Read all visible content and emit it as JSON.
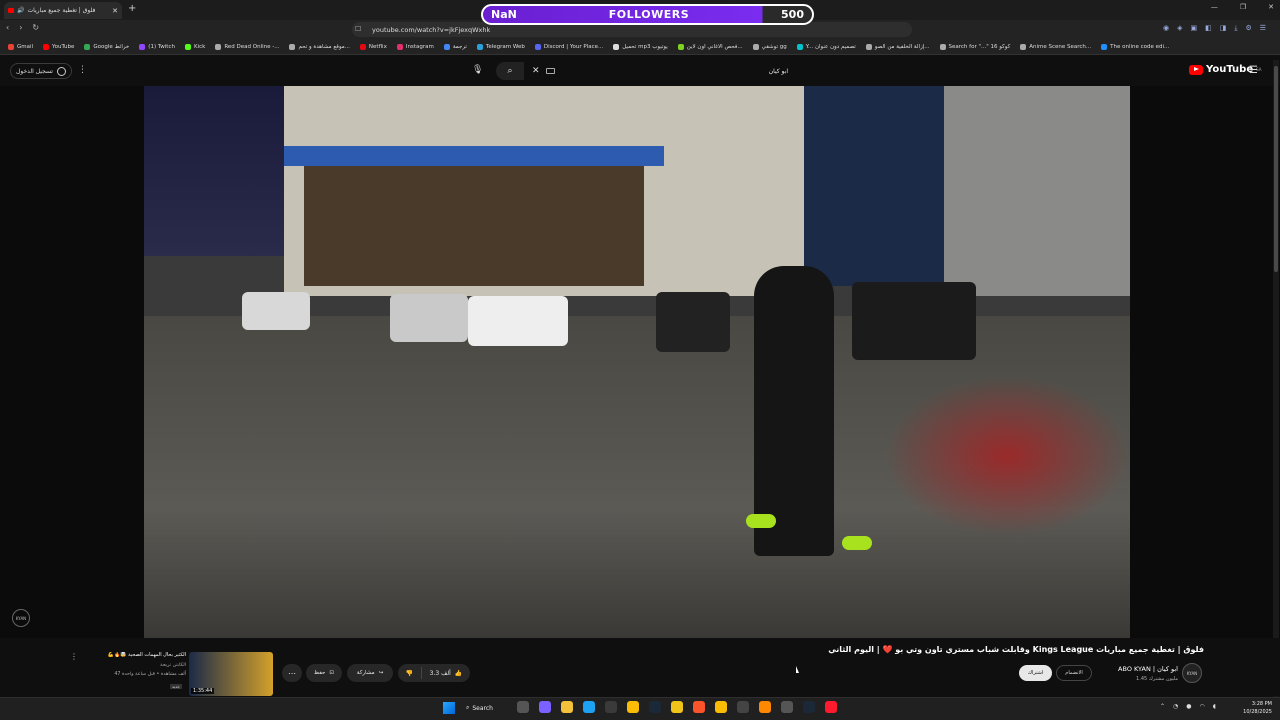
{
  "browser": {
    "tab_title": "فلوق | تغطية جميع مباريات",
    "new_tab": "+",
    "url": "youtube.com/watch?v=jkFjexqWxhk",
    "window_controls": [
      "—",
      "❐",
      "✕"
    ],
    "bookmarks": [
      {
        "label": "Gmail",
        "color": "#ea4335"
      },
      {
        "label": "YouTube",
        "color": "#ff0000"
      },
      {
        "label": "Google خرائط",
        "color": "#34a853"
      },
      {
        "label": "(1) Twitch",
        "color": "#9146ff"
      },
      {
        "label": "Kick",
        "color": "#53fc18"
      },
      {
        "label": "Red Dead Online -...",
        "color": "#aaaaaa"
      },
      {
        "label": "موقع مشاهدة و تحم...",
        "color": "#aaaaaa"
      },
      {
        "label": "Netflix",
        "color": "#e50914"
      },
      {
        "label": "Instagram",
        "color": "#e1306c"
      },
      {
        "label": "ترجمة",
        "color": "#4285f4"
      },
      {
        "label": "Telegram Web",
        "color": "#2aa1da"
      },
      {
        "label": "Discord | Your Place...",
        "color": "#5865f2"
      },
      {
        "label": "تحميل mp3 يوتيوب",
        "color": "#dddddd"
      },
      {
        "label": "فحص الاغاني اون لاين...",
        "color": "#7ed321"
      },
      {
        "label": "توشقي gg",
        "color": "#aaaaaa"
      },
      {
        "label": "Y... تصميم دون عنوان",
        "color": "#00c4cc"
      },
      {
        "label": "إزالة الخلفية من الصو...",
        "color": "#aaaaaa"
      },
      {
        "label": "Search for \"...\" كوكو 16",
        "color": "#aaaaaa"
      },
      {
        "label": "Anime Scene Search...",
        "color": "#aaaaaa"
      },
      {
        "label": "The online code edi...",
        "color": "#1e90ff"
      }
    ]
  },
  "overlay": {
    "left": "NaN",
    "label": "FOLLOWERS",
    "count": "500"
  },
  "youtube": {
    "signin": "تسجيل الدخول",
    "search_query": "ابو كيان",
    "logo": "YouTube",
    "logo_region": "SA",
    "video": {
      "title": "فلوق | تغطية جميع مباريات Kings League وقابلت شباب مستري تاون وتي بو ❤️ | اليوم الثاني",
      "channel": "ABO KYAN | ابو كيان",
      "subscribers": "1.45 مليون مشترك",
      "channel_avatar": "KYAN",
      "join": "الانضمام",
      "subscribe": "اشتراك",
      "likes": "3.3 ألف",
      "share": "مشاركة",
      "save": "حفظ",
      "more": "⋯"
    },
    "recommended": {
      "title": "الكثير بحال المهمات الصحية 🤯🔥💪",
      "channel": "الكابتن تريحة",
      "meta": "47 ألف مشاهدة • قبل ساعة واحدة",
      "duration": "1:35:44",
      "badge": "جديد"
    },
    "side_avatar": "KYAN"
  },
  "taskbar": {
    "search": "Search",
    "time": "3:28 PM",
    "date": "10/28/2025",
    "icons": [
      {
        "name": "task-view",
        "color": "#555555"
      },
      {
        "name": "copilot",
        "color": "#7b61ff"
      },
      {
        "name": "file-explorer",
        "color": "#f3c13a"
      },
      {
        "name": "edge",
        "color": "#1da1f2"
      },
      {
        "name": "store",
        "color": "#3a3a3a"
      },
      {
        "name": "chrome",
        "color": "#fbbc05"
      },
      {
        "name": "steam",
        "color": "#1b2838"
      },
      {
        "name": "app",
        "color": "#f0c419"
      },
      {
        "name": "brave",
        "color": "#fb542b"
      },
      {
        "name": "chrome-2",
        "color": "#fbbc05"
      },
      {
        "name": "obs",
        "color": "#444444"
      },
      {
        "name": "vlc",
        "color": "#ff8800"
      },
      {
        "name": "obs-2",
        "color": "#555555"
      },
      {
        "name": "steam-2",
        "color": "#1b2838"
      },
      {
        "name": "opera",
        "color": "#ff1b2d"
      }
    ]
  }
}
